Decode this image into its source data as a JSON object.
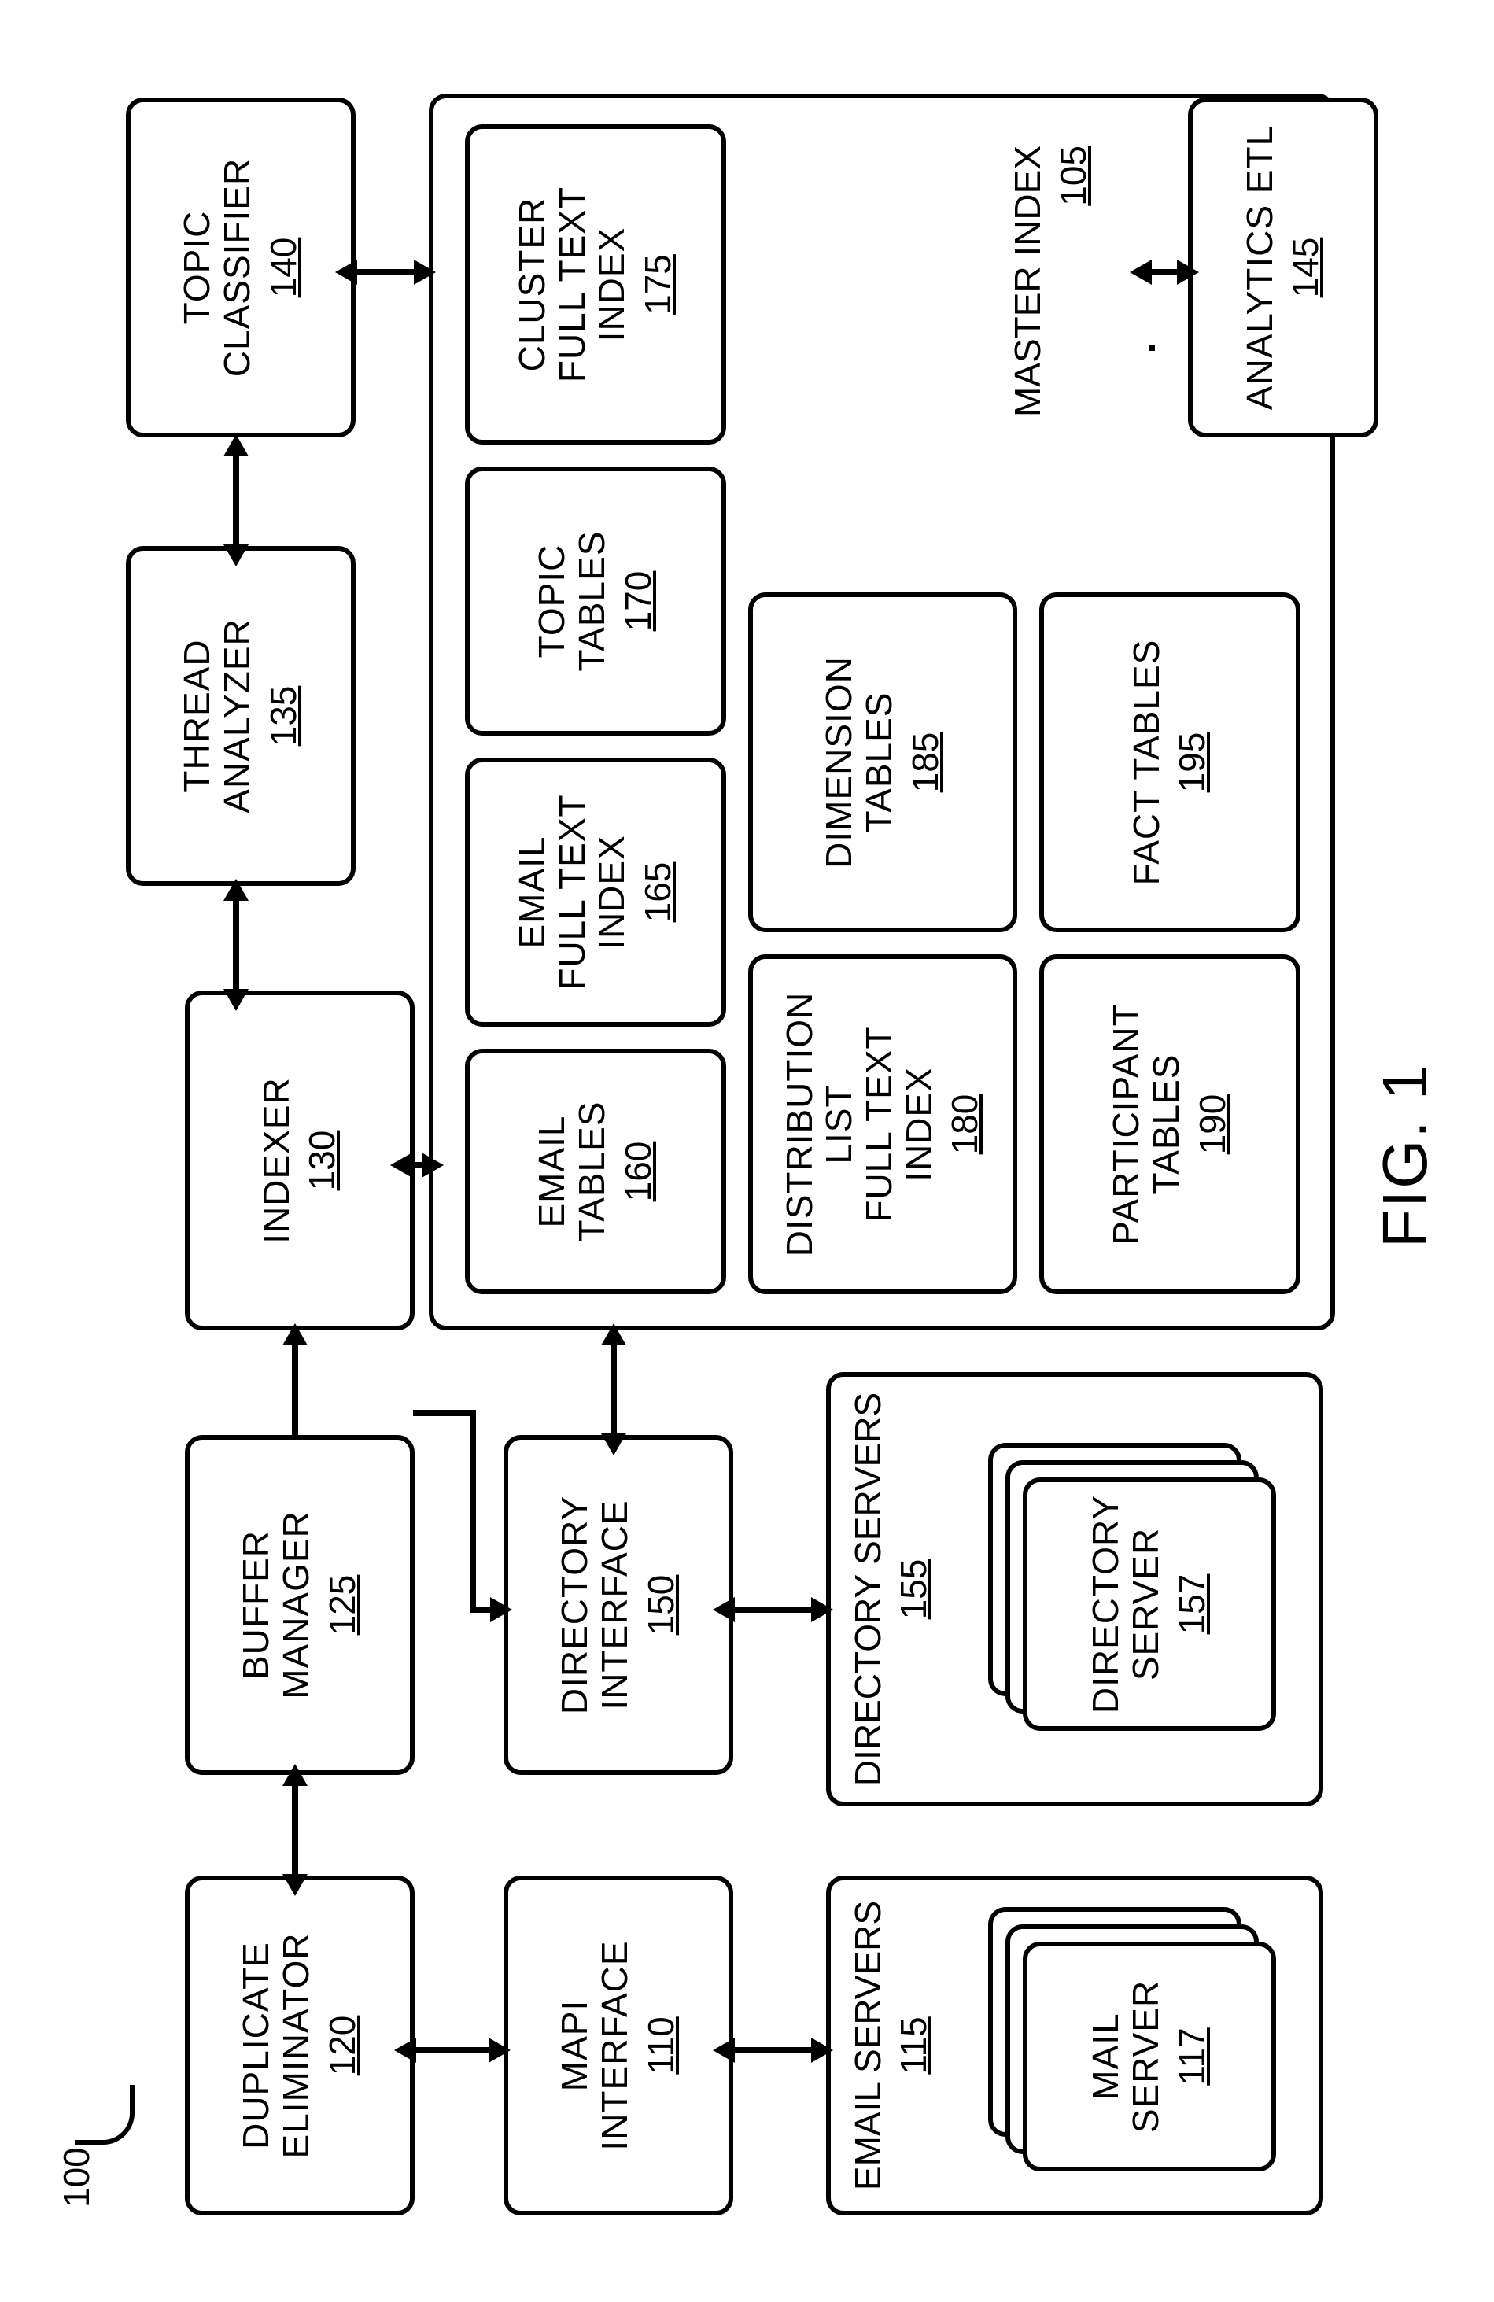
{
  "figure_ref": "100",
  "figure_label": "FIG. 1",
  "blocks": {
    "duplicate_eliminator": {
      "label": "DUPLICATE\nELIMINATOR",
      "num": "120"
    },
    "buffer_manager": {
      "label": "BUFFER\nMANAGER",
      "num": "125"
    },
    "indexer": {
      "label": "INDEXER",
      "num": "130"
    },
    "thread_analyzer": {
      "label": "THREAD\nANALYZER",
      "num": "135"
    },
    "topic_classifier": {
      "label": "TOPIC\nCLASSIFIER",
      "num": "140"
    },
    "mapi_interface": {
      "label": "MAPI\nINTERFACE",
      "num": "110"
    },
    "directory_interface": {
      "label": "DIRECTORY\nINTERFACE",
      "num": "150"
    },
    "analytics_etl": {
      "label": "ANALYTICS ETL",
      "num": "145"
    },
    "email_servers": {
      "label": "EMAIL SERVERS",
      "num": "115"
    },
    "mail_server": {
      "label": "MAIL SERVER",
      "num": "117"
    },
    "directory_servers": {
      "label": "DIRECTORY SERVERS",
      "num": "155"
    },
    "directory_server": {
      "label": "DIRECTORY\nSERVER",
      "num": "157"
    },
    "master_index": {
      "label": "MASTER INDEX",
      "num": "105"
    },
    "email_tables": {
      "label": "EMAIL\nTABLES",
      "num": "160"
    },
    "email_fti": {
      "label": "EMAIL\nFULL TEXT\nINDEX",
      "num": "165"
    },
    "topic_tables": {
      "label": "TOPIC\nTABLES",
      "num": "170"
    },
    "cluster_fti": {
      "label": "CLUSTER\nFULL TEXT\nINDEX",
      "num": "175"
    },
    "dist_list_fti": {
      "label": "DISTRIBUTION\nLIST\nFULL TEXT\nINDEX",
      "num": "180"
    },
    "dimension_tables": {
      "label": "DIMENSION\nTABLES",
      "num": "185"
    },
    "participant_tables": {
      "label": "PARTICIPANT\nTABLES",
      "num": "190"
    },
    "fact_tables": {
      "label": "FACT TABLES",
      "num": "195"
    }
  }
}
